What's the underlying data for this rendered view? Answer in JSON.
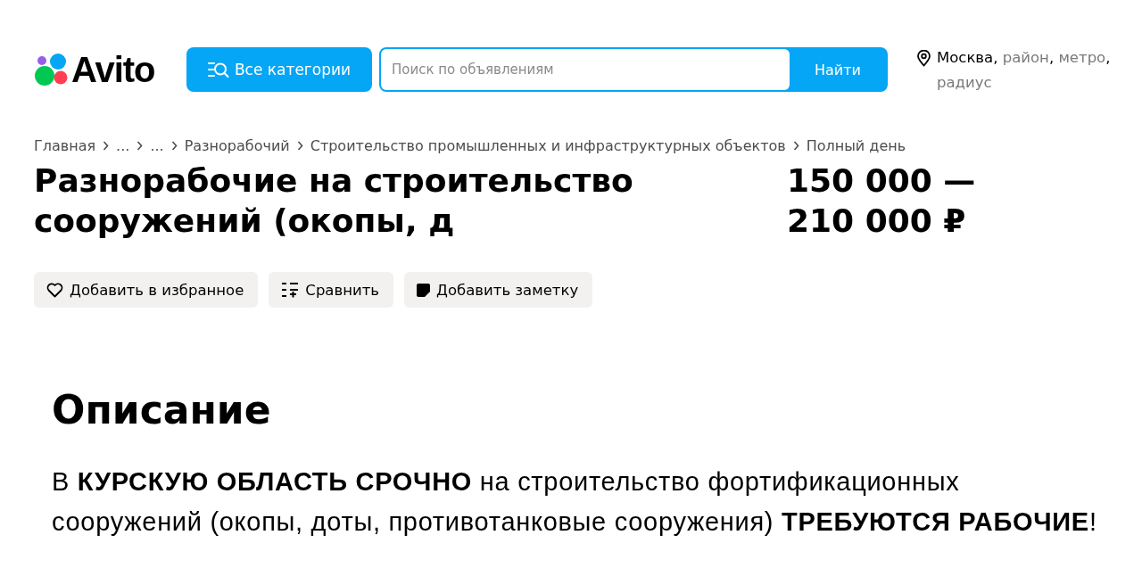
{
  "header": {
    "logo": "Avito",
    "categories_button": "Все категории",
    "search": {
      "placeholder": "Поиск по объявлениям",
      "button": "Найти"
    },
    "location": {
      "separator": ",",
      "items": [
        {
          "text": "Москва",
          "selected": true
        },
        {
          "text": "район",
          "selected": false
        },
        {
          "text": "метро",
          "selected": false
        },
        {
          "text": "радиус",
          "selected": false
        }
      ]
    }
  },
  "breadcrumbs": [
    "Главная",
    "...",
    "...",
    "Разнорабочий",
    "Строительство промышленных и инфраструктурных объектов",
    "Полный день"
  ],
  "listing": {
    "title": "Разнорабочие на строительство сооружений (окопы, д",
    "price": "150 000 — 210 000 ₽"
  },
  "actions": [
    {
      "kind": "favorite",
      "label": "Добавить в избранное"
    },
    {
      "kind": "compare",
      "label": "Сравнить"
    },
    {
      "kind": "note",
      "label": "Добавить заметку"
    }
  ],
  "description": {
    "heading": "Описание",
    "text": "В **КУРСКУЮ ОБЛАСТЬ СРОЧНО** на строительство фортификационных сооружений (окопы, доты, противотанковые сооружения) **ТРЕБУЮТСЯ РАБОЧИЕ**!"
  }
}
